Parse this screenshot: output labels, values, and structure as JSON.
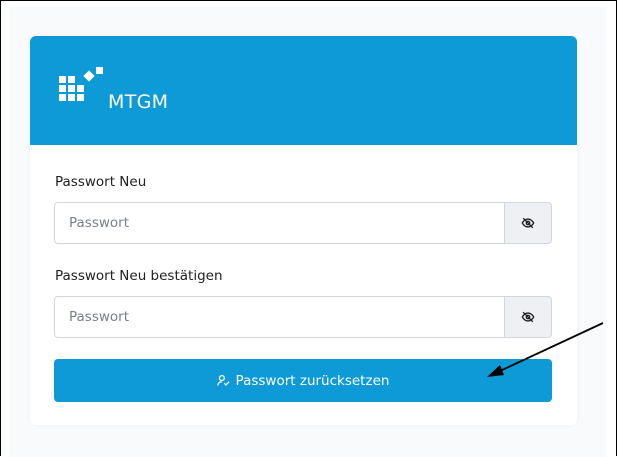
{
  "header": {
    "brand_name": "MTGM",
    "brand_color": "#0d9ad6",
    "logo_icon": "mtgm-logo-icon"
  },
  "form": {
    "new_password": {
      "label": "Passwort Neu",
      "placeholder": "Passwort",
      "value": "",
      "toggle_icon": "eye-slash-icon"
    },
    "confirm_password": {
      "label": "Passwort Neu bestätigen",
      "placeholder": "Passwort",
      "value": "",
      "toggle_icon": "eye-slash-icon"
    },
    "submit": {
      "label": "Passwort zurücksetzen",
      "icon": "user-reset-icon"
    }
  },
  "annotation": {
    "arrow_icon": "pointer-arrow-icon",
    "arrow_color": "#000000"
  }
}
